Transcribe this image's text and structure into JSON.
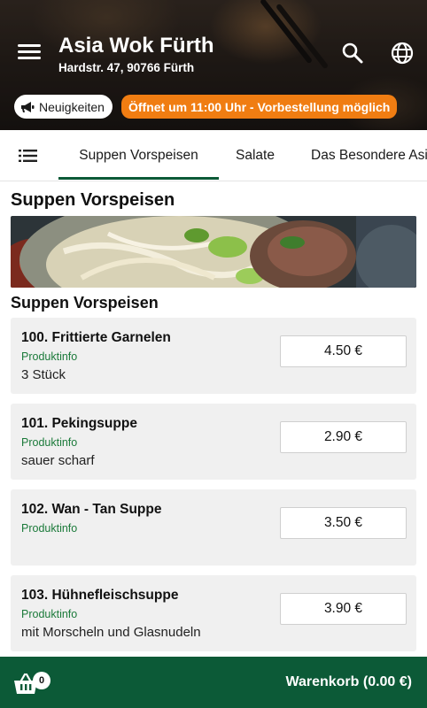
{
  "header": {
    "title": "Asia Wok Fürth",
    "address": "Hardstr. 47, 90766 Fürth",
    "news_label": "Neuigkeiten",
    "open_notice": "Öffnet um 11:00 Uhr - Vorbestellung möglich"
  },
  "tabs": [
    {
      "label": "Suppen Vorspeisen",
      "active": true
    },
    {
      "label": "Salate",
      "active": false
    },
    {
      "label": "Das Besondere Asiens",
      "active": false
    }
  ],
  "section": {
    "title": "Suppen Vorspeisen",
    "subtitle": "Suppen Vorspeisen"
  },
  "products": [
    {
      "name": "100. Frittierte Garnelen",
      "info": "Produktinfo",
      "description": "3 Stück",
      "price": "4.50 €"
    },
    {
      "name": "101. Pekingsuppe",
      "info": "Produktinfo",
      "description": "sauer scharf",
      "price": "2.90 €"
    },
    {
      "name": "102. Wan - Tan Suppe",
      "info": "Produktinfo",
      "description": "",
      "price": "3.50 €"
    },
    {
      "name": "103. Hühnefleischsuppe",
      "info": "Produktinfo",
      "description": "mit Morscheln und Glasnudeln",
      "price": "3.90 €"
    }
  ],
  "cart": {
    "count": "0",
    "label": "Warenkorb (0.00 €)"
  },
  "colors": {
    "brand_green": "#0c5a37",
    "accent_orange": "#f07d12",
    "info_green": "#1b7a3a"
  },
  "icons": [
    "menu-icon",
    "search-icon",
    "globe-icon",
    "megaphone-icon",
    "list-icon",
    "basket-icon"
  ]
}
